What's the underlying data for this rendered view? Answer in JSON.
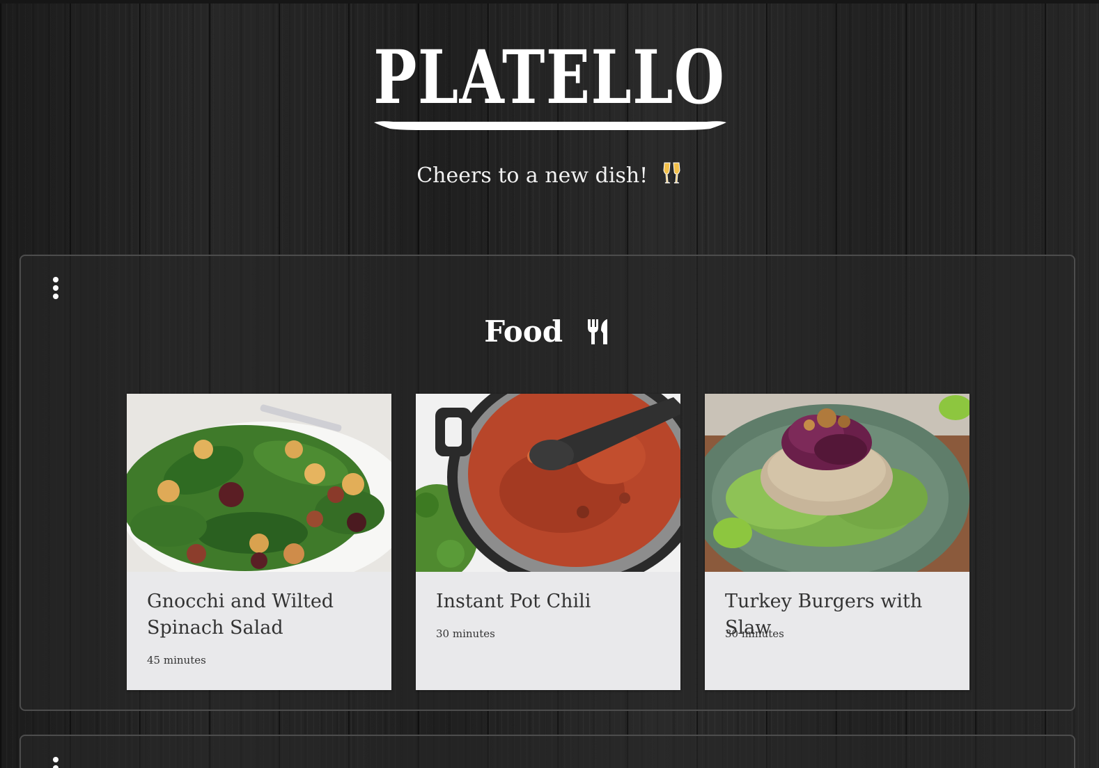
{
  "brand": {
    "title": "PLATELLO",
    "tagline": "Cheers to a new dish!",
    "tagline_icon": "champagne-glasses-icon"
  },
  "sections": [
    {
      "title": "Food",
      "title_icon": "utensils-icon",
      "menu_icon": "kebab-menu-icon",
      "recipes": [
        {
          "title": "Gnocchi and Wilted Spinach Salad",
          "time": "45 minutes",
          "image": "spinach-gnocchi-salad-photo"
        },
        {
          "title": "Instant Pot Chili",
          "time": "30 minutes",
          "image": "chili-pot-photo"
        },
        {
          "title": "Turkey Burgers with Slaw",
          "time": "30 minutes",
          "image": "turkey-burger-photo"
        }
      ]
    }
  ],
  "colors": {
    "background": "#232323",
    "card": "#e9e9eb",
    "text_light": "#ffffff",
    "text_dark": "#333333"
  }
}
